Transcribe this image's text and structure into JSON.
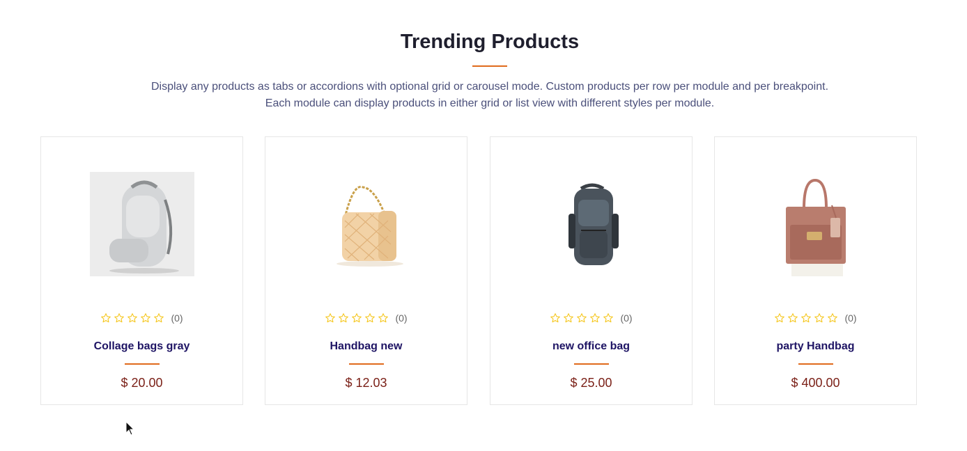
{
  "section": {
    "title": "Trending Products",
    "subtitle_line1": "Display any products as tabs or accordions with optional grid or carousel mode. Custom products per row per module and per breakpoint.",
    "subtitle_line2": "Each module can display products in either grid or list view with different styles per module."
  },
  "colors": {
    "accent": "#e06a1b",
    "product_name": "#1e1464",
    "price": "#7a1f16",
    "star": "#f5c518"
  },
  "products": [
    {
      "name": "Collage bags gray",
      "price": "$ 20.00",
      "rating_count": "(0)",
      "rating": 0,
      "image_icon": "gray-backpack-image"
    },
    {
      "name": "Handbag new",
      "price": "$ 12.03",
      "rating_count": "(0)",
      "rating": 0,
      "image_icon": "beige-handbag-image"
    },
    {
      "name": "new office bag",
      "price": "$ 25.00",
      "rating_count": "(0)",
      "rating": 0,
      "image_icon": "dark-backpack-image"
    },
    {
      "name": "party Handbag",
      "price": "$ 400.00",
      "rating_count": "(0)",
      "rating": 0,
      "image_icon": "brown-tote-image"
    }
  ]
}
